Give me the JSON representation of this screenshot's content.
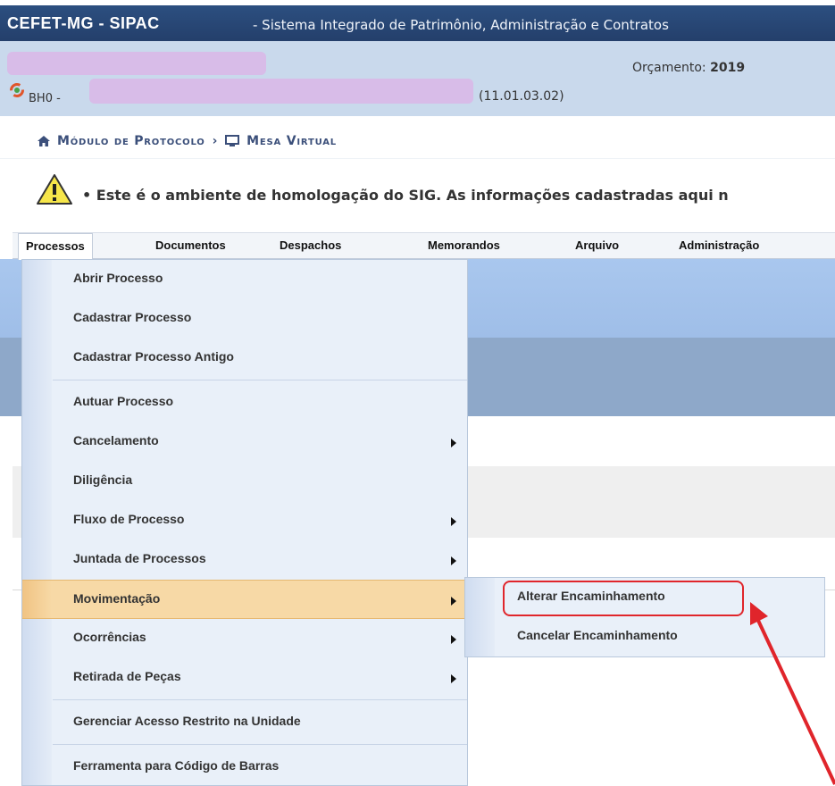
{
  "app": {
    "title": "CEFET-MG - SIPAC",
    "subtitle": "- Sistema Integrado de Patrimônio, Administração e Contratos"
  },
  "info": {
    "orcamento_label": "Orçamento:",
    "orcamento_year": "2019",
    "unit_prefix": "BH0 -",
    "unit_code": "(11.01.03.02)"
  },
  "breadcrumb": {
    "module": "Módulo de Protocolo",
    "separator": "›",
    "page": "Mesa Virtual"
  },
  "warning": {
    "text": "• Este é o ambiente de homologação do SIG. As informações cadastradas aqui n"
  },
  "menubar": {
    "items": [
      "Processos",
      "Documentos",
      "Despachos",
      "Memorandos",
      "Arquivo",
      "Administração"
    ]
  },
  "dropdown": {
    "items": [
      {
        "label": "Abrir Processo",
        "submenu": false
      },
      {
        "label": "Cadastrar Processo",
        "submenu": false
      },
      {
        "label": "Cadastrar Processo Antigo",
        "submenu": false
      },
      {
        "label": "Autuar Processo",
        "submenu": false
      },
      {
        "label": "Cancelamento",
        "submenu": true
      },
      {
        "label": "Diligência",
        "submenu": false
      },
      {
        "label": "Fluxo de Processo",
        "submenu": true
      },
      {
        "label": "Juntada de Processos",
        "submenu": true
      },
      {
        "label": "Movimentação",
        "submenu": true
      },
      {
        "label": "Ocorrências",
        "submenu": true
      },
      {
        "label": "Retirada de Peças",
        "submenu": true
      },
      {
        "label": "Gerenciar Acesso Restrito na Unidade",
        "submenu": false
      },
      {
        "label": "Ferramenta para Código de Barras",
        "submenu": false
      }
    ]
  },
  "submenu": {
    "items": [
      "Alterar Encaminhamento",
      "Cancelar Encaminhamento"
    ]
  },
  "colors": {
    "header_bg": "#243f6b",
    "info_bg": "#c9d9ec",
    "highlight": "#f7d9a6",
    "annotation": "#e0252b"
  }
}
